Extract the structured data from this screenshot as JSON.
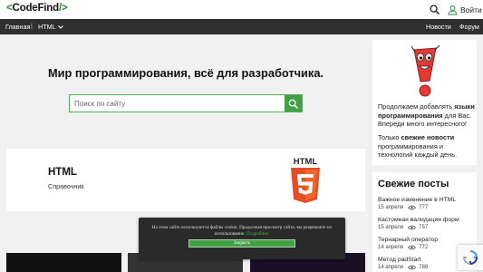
{
  "header": {
    "logo_open": "<",
    "logo_text": "CodeFind",
    "logo_close": "/>",
    "login_label": "Войти"
  },
  "nav": {
    "home": "Главная",
    "separator": "|",
    "html": "HTML",
    "news": "Новости",
    "forum": "Форум"
  },
  "hero": {
    "title": "Мир программирования, всё для разработчика.",
    "search_placeholder": "Поиск по сайту"
  },
  "card": {
    "title": "HTML",
    "subtitle": "Справочник",
    "badge_text": "HTML"
  },
  "sidebar": {
    "promo_prefix": "Продолжаем добавлять ",
    "promo_bold": "языки программирования",
    "promo_suffix": " для Вас. Впереди много интересного!",
    "news_prefix": "Только ",
    "news_bold": "свежие новости",
    "news_suffix": " программирования и технологий каждый день."
  },
  "posts": {
    "heading": "Свежие посты",
    "items": [
      {
        "title": "Важное изменение в HTML",
        "date": "15 апреля",
        "views": "777"
      },
      {
        "title": "Кастомная валидация форм",
        "date": "15 апреля",
        "views": "757"
      },
      {
        "title": "Тернарный оператор",
        "date": "14 апреля",
        "views": "772"
      },
      {
        "title": "Метод padStart",
        "date": "14 апреля",
        "views": "788"
      }
    ]
  },
  "cookie": {
    "text": "На этом сайте используются файлы cookie. Продолжая просмотр сайта, вы разрешаете их использование.",
    "more": "Подробнее.",
    "accept": "Закрыть"
  },
  "colors": {
    "accent": "#43a047",
    "navbar": "#2f2f2f",
    "html5_orange": "#e44d26"
  }
}
